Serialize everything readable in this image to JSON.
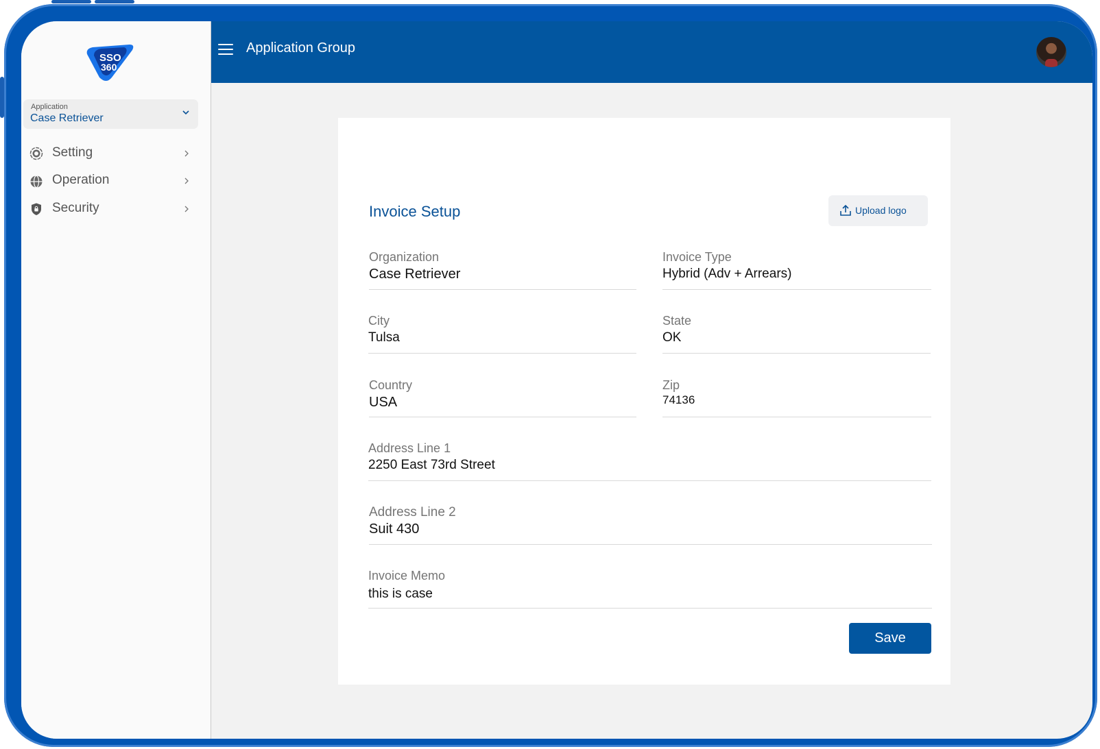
{
  "app": {
    "logo_text": "SSO 360"
  },
  "sidebar": {
    "app_selector": {
      "label": "Application",
      "value": "Case Retriever"
    },
    "items": [
      {
        "label": "Setting",
        "icon": "gear-icon"
      },
      {
        "label": "Operation",
        "icon": "globe-icon"
      },
      {
        "label": "Security",
        "icon": "shield-lock-icon"
      }
    ]
  },
  "header": {
    "title": "Application Group"
  },
  "form": {
    "title": "Invoice Setup",
    "upload_label": "Upload logo",
    "fields": {
      "organization": {
        "label": "Organization",
        "value": "Case Retriever"
      },
      "invoice_type": {
        "label": "Invoice Type",
        "value": "Hybrid (Adv + Arrears)"
      },
      "city": {
        "label": "City",
        "value": "Tulsa"
      },
      "state": {
        "label": "State",
        "value": "OK"
      },
      "country": {
        "label": "Country",
        "value": "USA"
      },
      "zip": {
        "label": "Zip",
        "value": "74136"
      },
      "address1": {
        "label": "Address Line 1",
        "value": "2250 East 73rd Street"
      },
      "address2": {
        "label": "Address Line 2",
        "value": "Suit 430"
      },
      "memo": {
        "label": "Invoice Memo",
        "value": "this is case"
      }
    },
    "save_label": "Save"
  },
  "colors": {
    "brand": "#0256a0",
    "accent_text": "#0a5297",
    "frame": "#0256b3"
  }
}
